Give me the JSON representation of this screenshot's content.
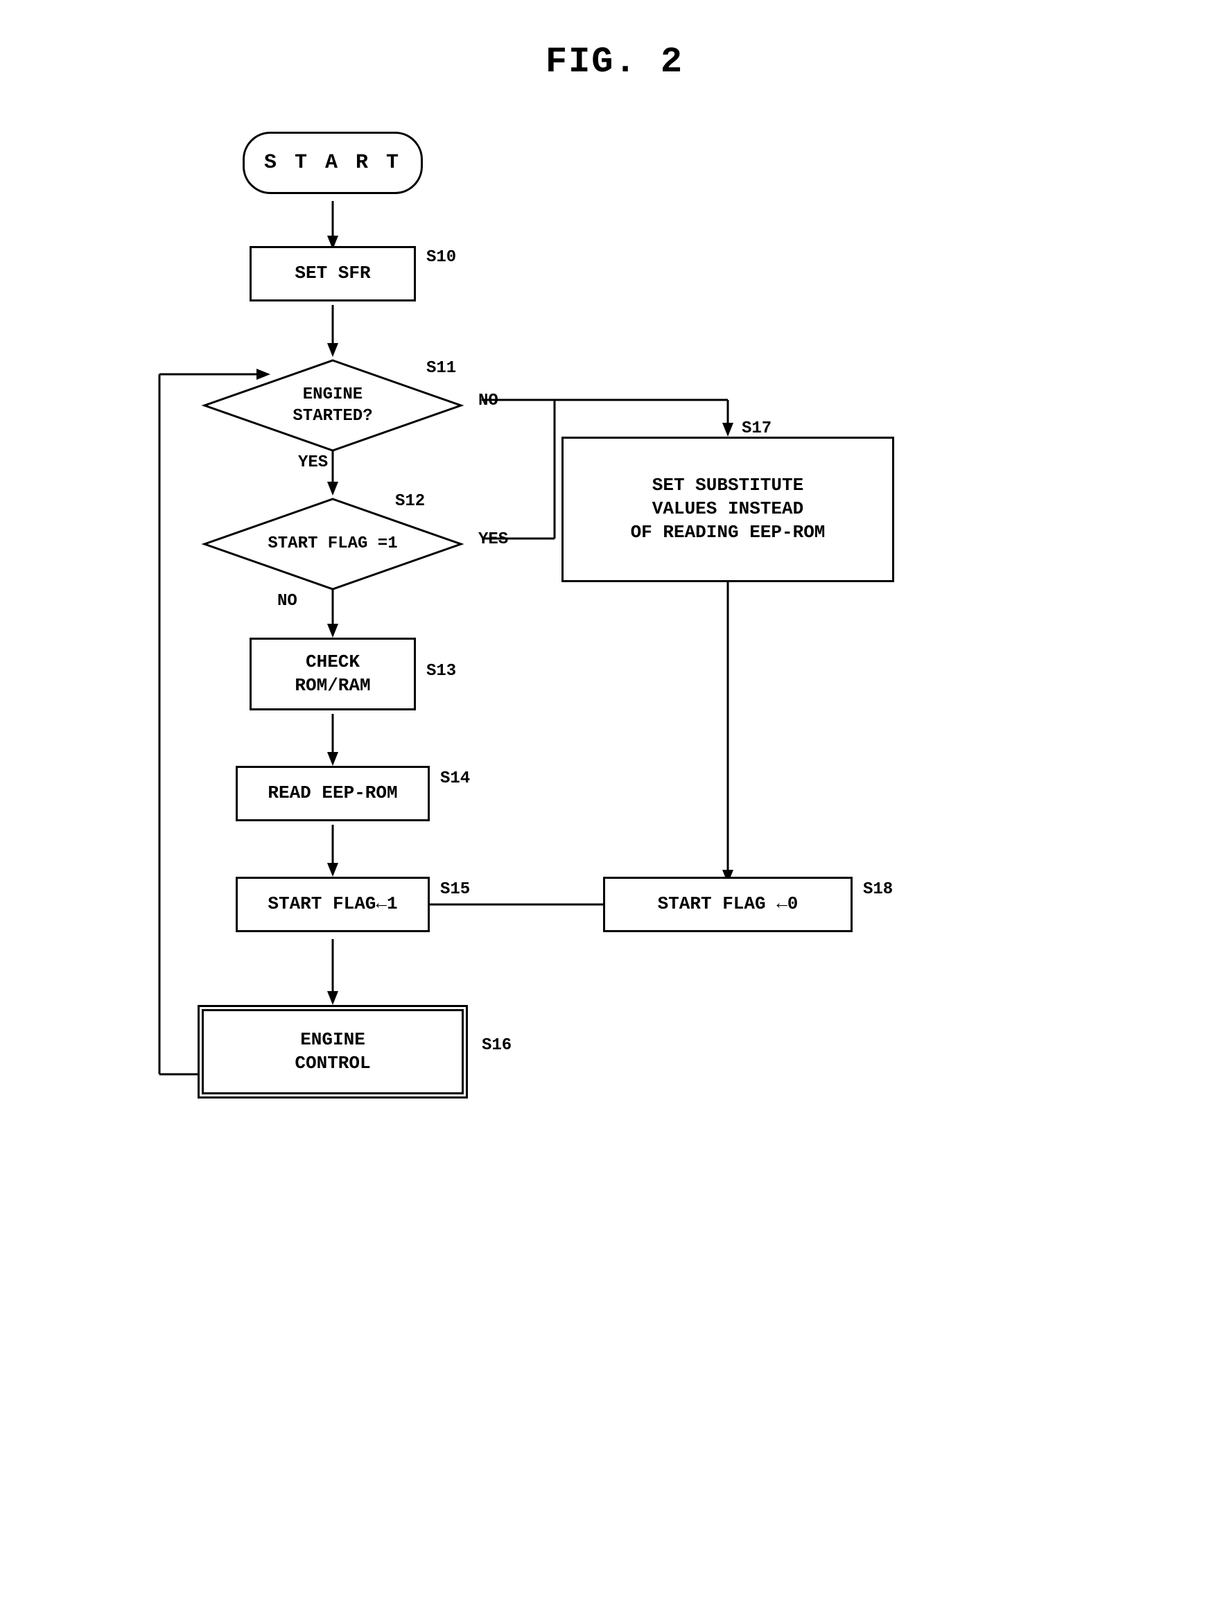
{
  "title": "FIG. 2",
  "nodes": {
    "start": {
      "label": "S T A R T"
    },
    "s10": {
      "label": "SET SFR",
      "step": "S10"
    },
    "s11": {
      "label": "ENGINE STARTED?",
      "step": "S11",
      "yes": "YES",
      "no": "NO"
    },
    "s12": {
      "label": "START FLAG =1",
      "step": "S12",
      "yes": "YES",
      "no": "NO"
    },
    "s13": {
      "label": "CHECK\nROM/RAM",
      "step": "S13"
    },
    "s14": {
      "label": "READ EEP-ROM",
      "step": "S14"
    },
    "s15": {
      "label": "START FLAG←1",
      "step": "S15"
    },
    "s16": {
      "label": "ENGINE\nCONTROL",
      "step": "S16"
    },
    "s17": {
      "label": "SET SUBSTITUTE\nVALUES INSTEAD\nOF READING EEP-ROM",
      "step": "S17"
    },
    "s18": {
      "label": "START FLAG ←0",
      "step": "S18"
    }
  }
}
